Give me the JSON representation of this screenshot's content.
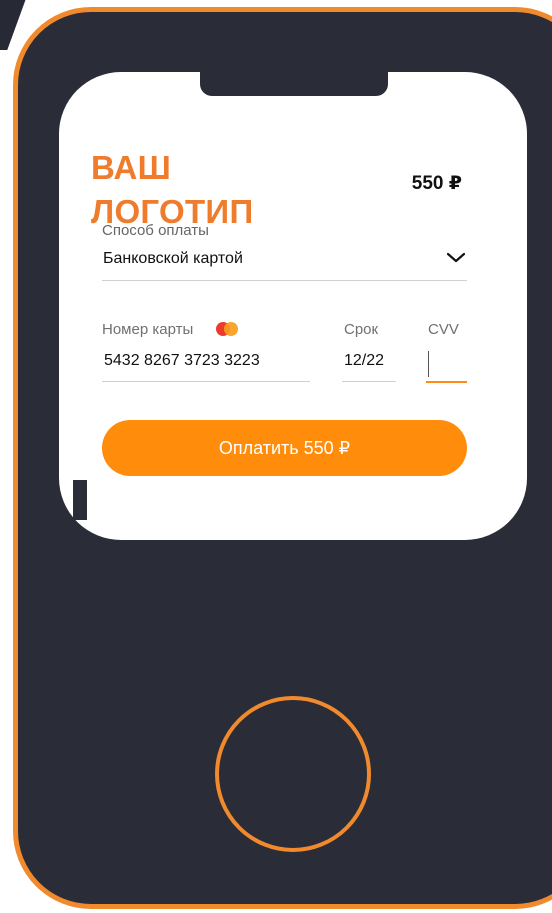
{
  "brand": {
    "logo_line1": "ВАШ",
    "logo_line2": "ЛОГОТИП"
  },
  "order": {
    "total": "550 ₽"
  },
  "payment_method": {
    "label": "Способ оплаты",
    "selected": "Банковской картой",
    "icon": "chevron-down-icon"
  },
  "card": {
    "number_label": "Номер карты",
    "number_value": "5432 8267 3723 3223",
    "brand_icon": "mastercard-icon",
    "expiry_label": "Срок",
    "expiry_value": "12/22",
    "cvv_label": "CVV",
    "cvv_value": ""
  },
  "actions": {
    "pay_label": "Оплатить 550 ₽"
  },
  "colors": {
    "accent": "#ff8c0a",
    "logo": "#ef7b2c",
    "phone_body": "#2a2c37",
    "phone_outline": "#f08a2d"
  }
}
